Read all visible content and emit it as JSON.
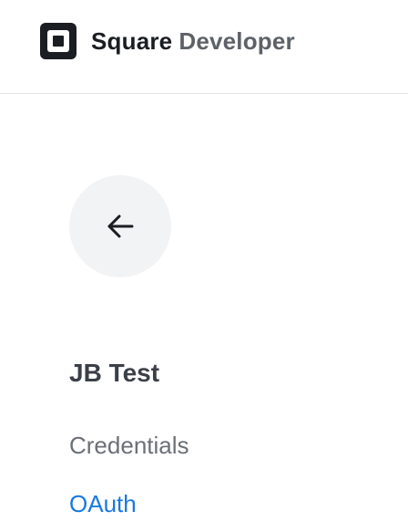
{
  "header": {
    "brand_primary": "Square",
    "brand_secondary": "Developer",
    "logo_icon": "square-logo-icon"
  },
  "back_button": {
    "icon": "arrow-left-icon"
  },
  "app": {
    "title": "JB Test"
  },
  "nav": {
    "items": [
      {
        "label": "Credentials",
        "color": "#6b7076"
      },
      {
        "label": "OAuth",
        "color": "#1a78e0"
      }
    ]
  }
}
